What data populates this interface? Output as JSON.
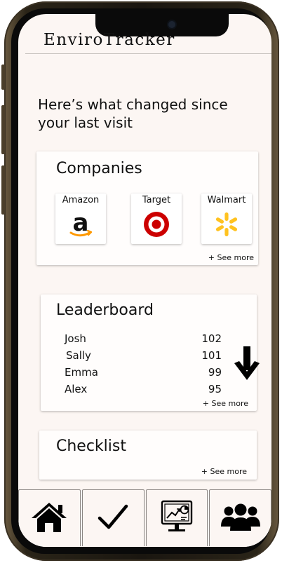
{
  "app": {
    "title": "EnviroTracker"
  },
  "headline": "Here’s what changed since your last visit",
  "companies": {
    "title": "Companies",
    "items": [
      {
        "name": "Amazon",
        "icon": "amazon-logo-icon"
      },
      {
        "name": "Target",
        "icon": "target-logo-icon"
      },
      {
        "name": "Walmart",
        "icon": "walmart-logo-icon"
      }
    ],
    "see_more": "+ See more"
  },
  "leaderboard": {
    "title": "Leaderboard",
    "rows": [
      {
        "name": "Josh",
        "score": "102"
      },
      {
        "name": "Sally",
        "score": "101"
      },
      {
        "name": "Emma",
        "score": "99"
      },
      {
        "name": "Alex",
        "score": "95"
      }
    ],
    "trend_icon": "arrow-down-icon",
    "see_more": "+ See more"
  },
  "checklist": {
    "title": "Checklist",
    "see_more": "+ See more"
  },
  "tabbar": {
    "tabs": [
      {
        "icon": "home-icon"
      },
      {
        "icon": "checkmark-icon"
      },
      {
        "icon": "analytics-dashboard-icon"
      },
      {
        "icon": "community-group-icon"
      }
    ]
  },
  "colors": {
    "screen_bg": "#fcf6f3",
    "target_red": "#cc0000",
    "walmart_yellow": "#ffc220",
    "amazon_orange": "#ff9900"
  }
}
